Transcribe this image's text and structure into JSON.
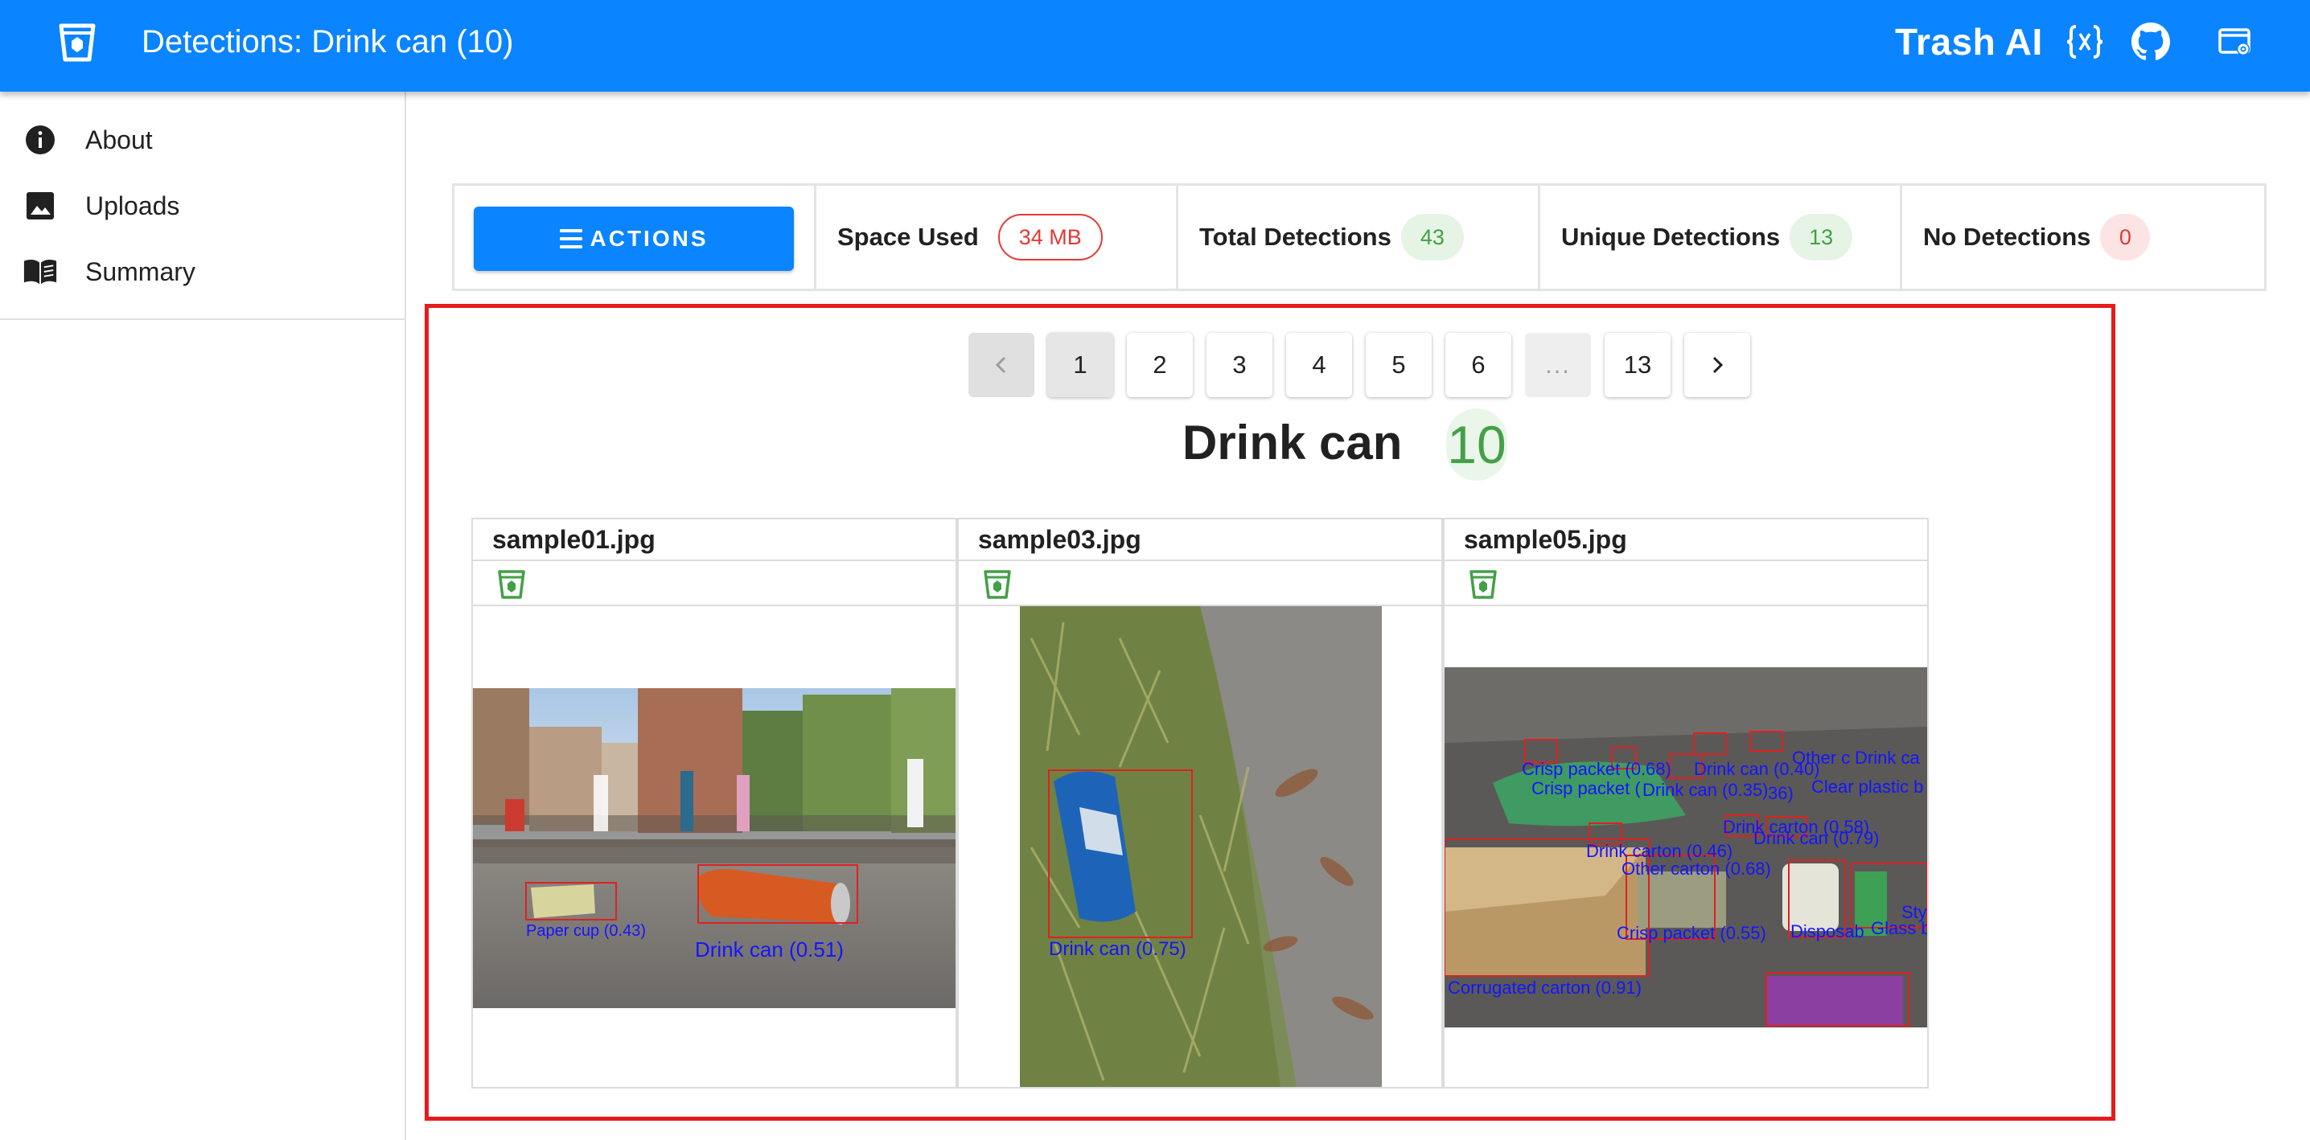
{
  "appbar": {
    "title": "Detections: Drink can (10)",
    "brand": "Trash AI",
    "icons": [
      "trash-logo-icon",
      "code-braces-icon",
      "github-icon",
      "settings-window-icon"
    ]
  },
  "sidebar": {
    "items": [
      {
        "label": "About",
        "icon": "info-icon"
      },
      {
        "label": "Uploads",
        "icon": "image-icon"
      },
      {
        "label": "Summary",
        "icon": "book-icon"
      }
    ]
  },
  "stats": {
    "actions_label": "ACTIONS",
    "space_used_label": "Space Used",
    "space_used_value": "34 MB",
    "total_label": "Total Detections",
    "total_value": "43",
    "unique_label": "Unique Detections",
    "unique_value": "13",
    "none_label": "No Detections",
    "none_value": "0"
  },
  "pagination": {
    "prev": "‹",
    "pages": [
      "1",
      "2",
      "3",
      "4",
      "5",
      "6"
    ],
    "ellipsis": "...",
    "last": "13",
    "next": "›",
    "current": "1"
  },
  "detection": {
    "name": "Drink can",
    "count": "10"
  },
  "images": [
    {
      "file": "sample01.jpg",
      "labels": [
        "Paper cup (0.43)",
        "Drink can (0.51)"
      ]
    },
    {
      "file": "sample03.jpg",
      "labels": [
        "Drink can (0.75)"
      ]
    },
    {
      "file": "sample05.jpg",
      "labels": [
        "Crisp packet (0.68)",
        "Drink can (0.40)",
        "Other c",
        "Drink ca",
        "Crisp packet (",
        "Drink can (0.35)",
        "36)",
        "Clear plastic b",
        "Drink carton (0.58)",
        "Drink can (0.79)",
        "Drink carton (0.46)",
        "Other carton (0.68)",
        "Sty",
        "Crisp packet (0.55)",
        "Disposab",
        "Glass b",
        "Corrugated carton (0.91)"
      ]
    }
  ],
  "colors": {
    "primary": "#0a84ff",
    "highlight_border": "#e61b1b",
    "success": "#43a047",
    "error": "#e53935",
    "box_stroke": "#e02020",
    "label_text": "#1515ff"
  }
}
